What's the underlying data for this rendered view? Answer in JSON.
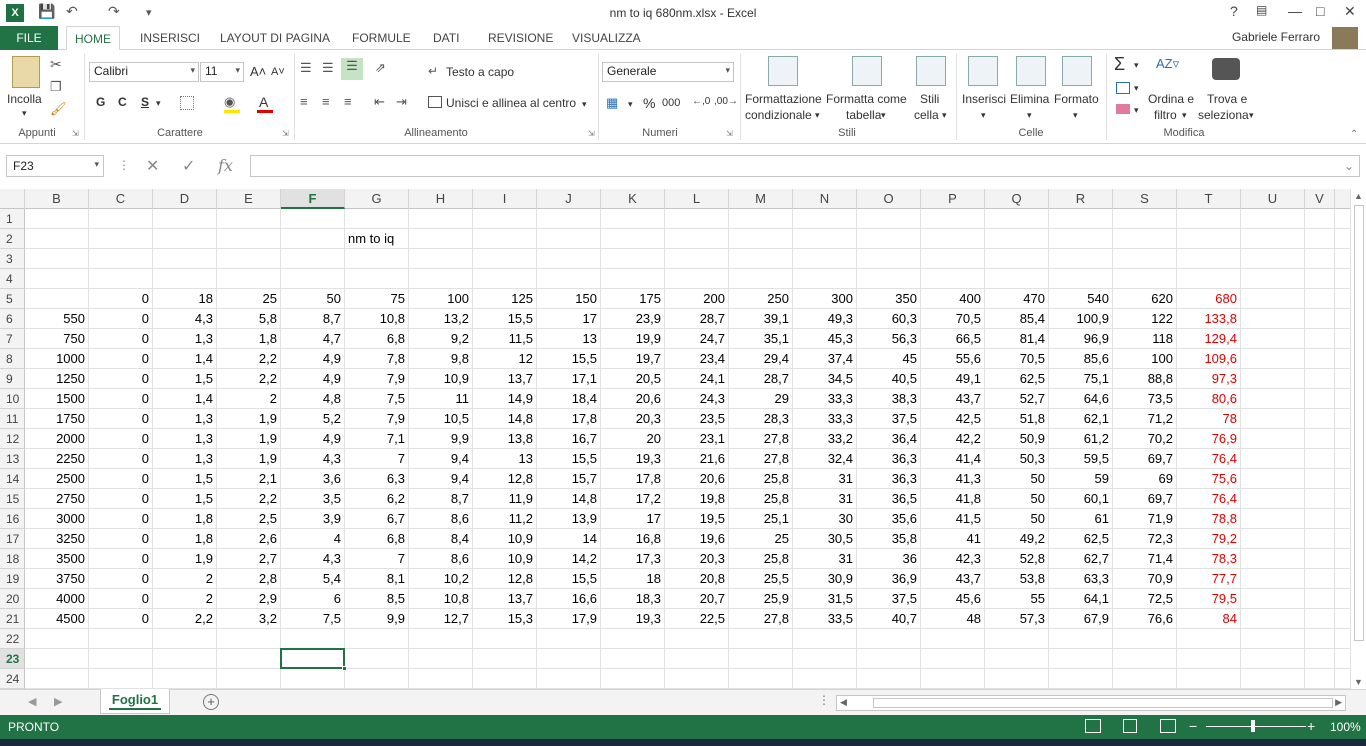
{
  "window": {
    "title": "nm to iq 680nm.xlsx - Excel",
    "logo": "X",
    "help": "?",
    "minimize": "—",
    "restore": "□",
    "close": "✕"
  },
  "ribbon": {
    "file_tab": "FILE",
    "tabs": [
      "HOME",
      "INSERISCI",
      "LAYOUT DI PAGINA",
      "FORMULE",
      "DATI",
      "REVISIONE",
      "VISUALIZZA"
    ],
    "user": "Gabriele Ferraro",
    "clipboard": {
      "paste": "Incolla",
      "group": "Appunti"
    },
    "font": {
      "name": "Calibri",
      "size": "11",
      "bold": "G",
      "italic": "C",
      "underline": "S",
      "group": "Carattere"
    },
    "alignment": {
      "wrap": "Testo a capo",
      "merge": "Unisci e allinea al centro",
      "group": "Allineamento"
    },
    "number": {
      "format": "Generale",
      "percent": "%",
      "thousands": "000",
      "group": "Numeri"
    },
    "styles": {
      "conditional_1": "Formattazione",
      "conditional_2": "condizionale",
      "table_1": "Formatta come",
      "table_2": "tabella",
      "cell_1": "Stili",
      "cell_2": "cella",
      "group": "Stili"
    },
    "cells": {
      "insert": "Inserisci",
      "delete": "Elimina",
      "format": "Formato",
      "group": "Celle"
    },
    "editing": {
      "sort_1": "Ordina e",
      "sort_2": "filtro",
      "find_1": "Trova e",
      "find_2": "seleziona",
      "group": "Modifica"
    }
  },
  "formula_bar": {
    "name_box": "F23",
    "fx": "fx",
    "formula": ""
  },
  "sheet": {
    "columns": [
      "B",
      "C",
      "D",
      "E",
      "F",
      "G",
      "H",
      "I",
      "J",
      "K",
      "L",
      "M",
      "N",
      "O",
      "P",
      "Q",
      "R",
      "S",
      "T",
      "U",
      "V"
    ],
    "selected_column": "F",
    "selected_row": "23",
    "rows": [
      "1",
      "2",
      "3",
      "4",
      "5",
      "6",
      "7",
      "8",
      "9",
      "10",
      "11",
      "12",
      "13",
      "14",
      "15",
      "16",
      "17",
      "18",
      "19",
      "20",
      "21",
      "22",
      "23",
      "24"
    ],
    "title_cell": "nm to iq",
    "header_row": [
      "",
      "0",
      "18",
      "25",
      "50",
      "75",
      "100",
      "125",
      "150",
      "175",
      "200",
      "250",
      "300",
      "350",
      "400",
      "470",
      "540",
      "620",
      "680"
    ],
    "data": [
      [
        "550",
        "0",
        "4,3",
        "5,8",
        "8,7",
        "10,8",
        "13,2",
        "15,5",
        "17",
        "23,9",
        "28,7",
        "39,1",
        "49,3",
        "60,3",
        "70,5",
        "85,4",
        "100,9",
        "122",
        "133,8"
      ],
      [
        "750",
        "0",
        "1,3",
        "1,8",
        "4,7",
        "6,8",
        "9,2",
        "11,5",
        "13",
        "19,9",
        "24,7",
        "35,1",
        "45,3",
        "56,3",
        "66,5",
        "81,4",
        "96,9",
        "118",
        "129,4"
      ],
      [
        "1000",
        "0",
        "1,4",
        "2,2",
        "4,9",
        "7,8",
        "9,8",
        "12",
        "15,5",
        "19,7",
        "23,4",
        "29,4",
        "37,4",
        "45",
        "55,6",
        "70,5",
        "85,6",
        "100",
        "109,6"
      ],
      [
        "1250",
        "0",
        "1,5",
        "2,2",
        "4,9",
        "7,9",
        "10,9",
        "13,7",
        "17,1",
        "20,5",
        "24,1",
        "28,7",
        "34,5",
        "40,5",
        "49,1",
        "62,5",
        "75,1",
        "88,8",
        "97,3"
      ],
      [
        "1500",
        "0",
        "1,4",
        "2",
        "4,8",
        "7,5",
        "11",
        "14,9",
        "18,4",
        "20,6",
        "24,3",
        "29",
        "33,3",
        "38,3",
        "43,7",
        "52,7",
        "64,6",
        "73,5",
        "80,6"
      ],
      [
        "1750",
        "0",
        "1,3",
        "1,9",
        "5,2",
        "7,9",
        "10,5",
        "14,8",
        "17,8",
        "20,3",
        "23,5",
        "28,3",
        "33,3",
        "37,5",
        "42,5",
        "51,8",
        "62,1",
        "71,2",
        "78"
      ],
      [
        "2000",
        "0",
        "1,3",
        "1,9",
        "4,9",
        "7,1",
        "9,9",
        "13,8",
        "16,7",
        "20",
        "23,1",
        "27,8",
        "33,2",
        "36,4",
        "42,2",
        "50,9",
        "61,2",
        "70,2",
        "76,9"
      ],
      [
        "2250",
        "0",
        "1,3",
        "1,9",
        "4,3",
        "7",
        "9,4",
        "13",
        "15,5",
        "19,3",
        "21,6",
        "27,8",
        "32,4",
        "36,3",
        "41,4",
        "50,3",
        "59,5",
        "69,7",
        "76,4"
      ],
      [
        "2500",
        "0",
        "1,5",
        "2,1",
        "3,6",
        "6,3",
        "9,4",
        "12,8",
        "15,7",
        "17,8",
        "20,6",
        "25,8",
        "31",
        "36,3",
        "41,3",
        "50",
        "59",
        "69",
        "75,6"
      ],
      [
        "2750",
        "0",
        "1,5",
        "2,2",
        "3,5",
        "6,2",
        "8,7",
        "11,9",
        "14,8",
        "17,2",
        "19,8",
        "25,8",
        "31",
        "36,5",
        "41,8",
        "50",
        "60,1",
        "69,7",
        "76,4"
      ],
      [
        "3000",
        "0",
        "1,8",
        "2,5",
        "3,9",
        "6,7",
        "8,6",
        "11,2",
        "13,9",
        "17",
        "19,5",
        "25,1",
        "30",
        "35,6",
        "41,5",
        "50",
        "61",
        "71,9",
        "78,8"
      ],
      [
        "3250",
        "0",
        "1,8",
        "2,6",
        "4",
        "6,8",
        "8,4",
        "10,9",
        "14",
        "16,8",
        "19,6",
        "25",
        "30,5",
        "35,8",
        "41",
        "49,2",
        "62,5",
        "72,3",
        "79,2"
      ],
      [
        "3500",
        "0",
        "1,9",
        "2,7",
        "4,3",
        "7",
        "8,6",
        "10,9",
        "14,2",
        "17,3",
        "20,3",
        "25,8",
        "31",
        "36",
        "42,3",
        "52,8",
        "62,7",
        "71,4",
        "78,3"
      ],
      [
        "3750",
        "0",
        "2",
        "2,8",
        "5,4",
        "8,1",
        "10,2",
        "12,8",
        "15,5",
        "18",
        "20,8",
        "25,5",
        "30,9",
        "36,9",
        "43,7",
        "53,8",
        "63,3",
        "70,9",
        "77,7"
      ],
      [
        "4000",
        "0",
        "2",
        "2,9",
        "6",
        "8,5",
        "10,8",
        "13,7",
        "16,6",
        "18,3",
        "20,7",
        "25,9",
        "31,5",
        "37,5",
        "45,6",
        "55",
        "64,1",
        "72,5",
        "79,5"
      ],
      [
        "4500",
        "0",
        "2,2",
        "3,2",
        "7,5",
        "9,9",
        "12,7",
        "15,3",
        "17,9",
        "19,3",
        "22,5",
        "27,8",
        "33,5",
        "40,7",
        "48",
        "57,3",
        "67,9",
        "76,6",
        "84"
      ]
    ],
    "highlight_color": "#e00000",
    "tab_name": "Foglio1",
    "add_sheet": "+"
  },
  "status": {
    "ready": "PRONTO",
    "zoom": "100%",
    "zoom_minus": "−",
    "zoom_plus": "+"
  },
  "accent_color": "#217346"
}
